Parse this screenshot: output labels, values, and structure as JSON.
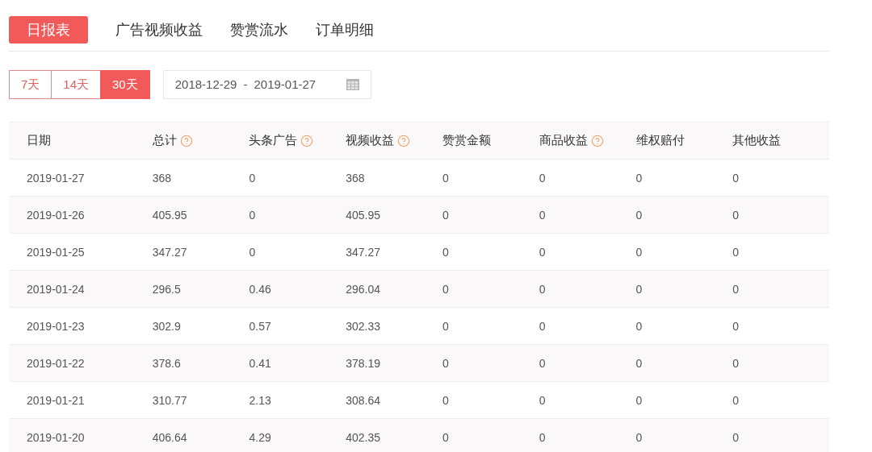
{
  "tabs": [
    {
      "label": "日报表",
      "selected": true
    },
    {
      "label": "广告视频收益",
      "selected": false
    },
    {
      "label": "赞赏流水",
      "selected": false
    },
    {
      "label": "订单明细",
      "selected": false
    }
  ],
  "ranges": [
    {
      "label": "7天",
      "selected": false
    },
    {
      "label": "14天",
      "selected": false
    },
    {
      "label": "30天",
      "selected": true
    }
  ],
  "date_range": {
    "start": "2018-12-29",
    "separator": "-",
    "end": "2019-01-27"
  },
  "table": {
    "columns": [
      {
        "label": "日期",
        "help": false
      },
      {
        "label": "总计",
        "help": true
      },
      {
        "label": "头条广告",
        "help": true
      },
      {
        "label": "视频收益",
        "help": true
      },
      {
        "label": "赞赏金额",
        "help": false
      },
      {
        "label": "商品收益",
        "help": true
      },
      {
        "label": "维权赔付",
        "help": false
      },
      {
        "label": "其他收益",
        "help": false
      }
    ],
    "rows": [
      [
        "2019-01-27",
        "368",
        "0",
        "368",
        "0",
        "0",
        "0",
        "0"
      ],
      [
        "2019-01-26",
        "405.95",
        "0",
        "405.95",
        "0",
        "0",
        "0",
        "0"
      ],
      [
        "2019-01-25",
        "347.27",
        "0",
        "347.27",
        "0",
        "0",
        "0",
        "0"
      ],
      [
        "2019-01-24",
        "296.5",
        "0.46",
        "296.04",
        "0",
        "0",
        "0",
        "0"
      ],
      [
        "2019-01-23",
        "302.9",
        "0.57",
        "302.33",
        "0",
        "0",
        "0",
        "0"
      ],
      [
        "2019-01-22",
        "378.6",
        "0.41",
        "378.19",
        "0",
        "0",
        "0",
        "0"
      ],
      [
        "2019-01-21",
        "310.77",
        "2.13",
        "308.64",
        "0",
        "0",
        "0",
        "0"
      ],
      [
        "2019-01-20",
        "406.64",
        "4.29",
        "402.35",
        "0",
        "0",
        "0",
        "0"
      ]
    ]
  }
}
